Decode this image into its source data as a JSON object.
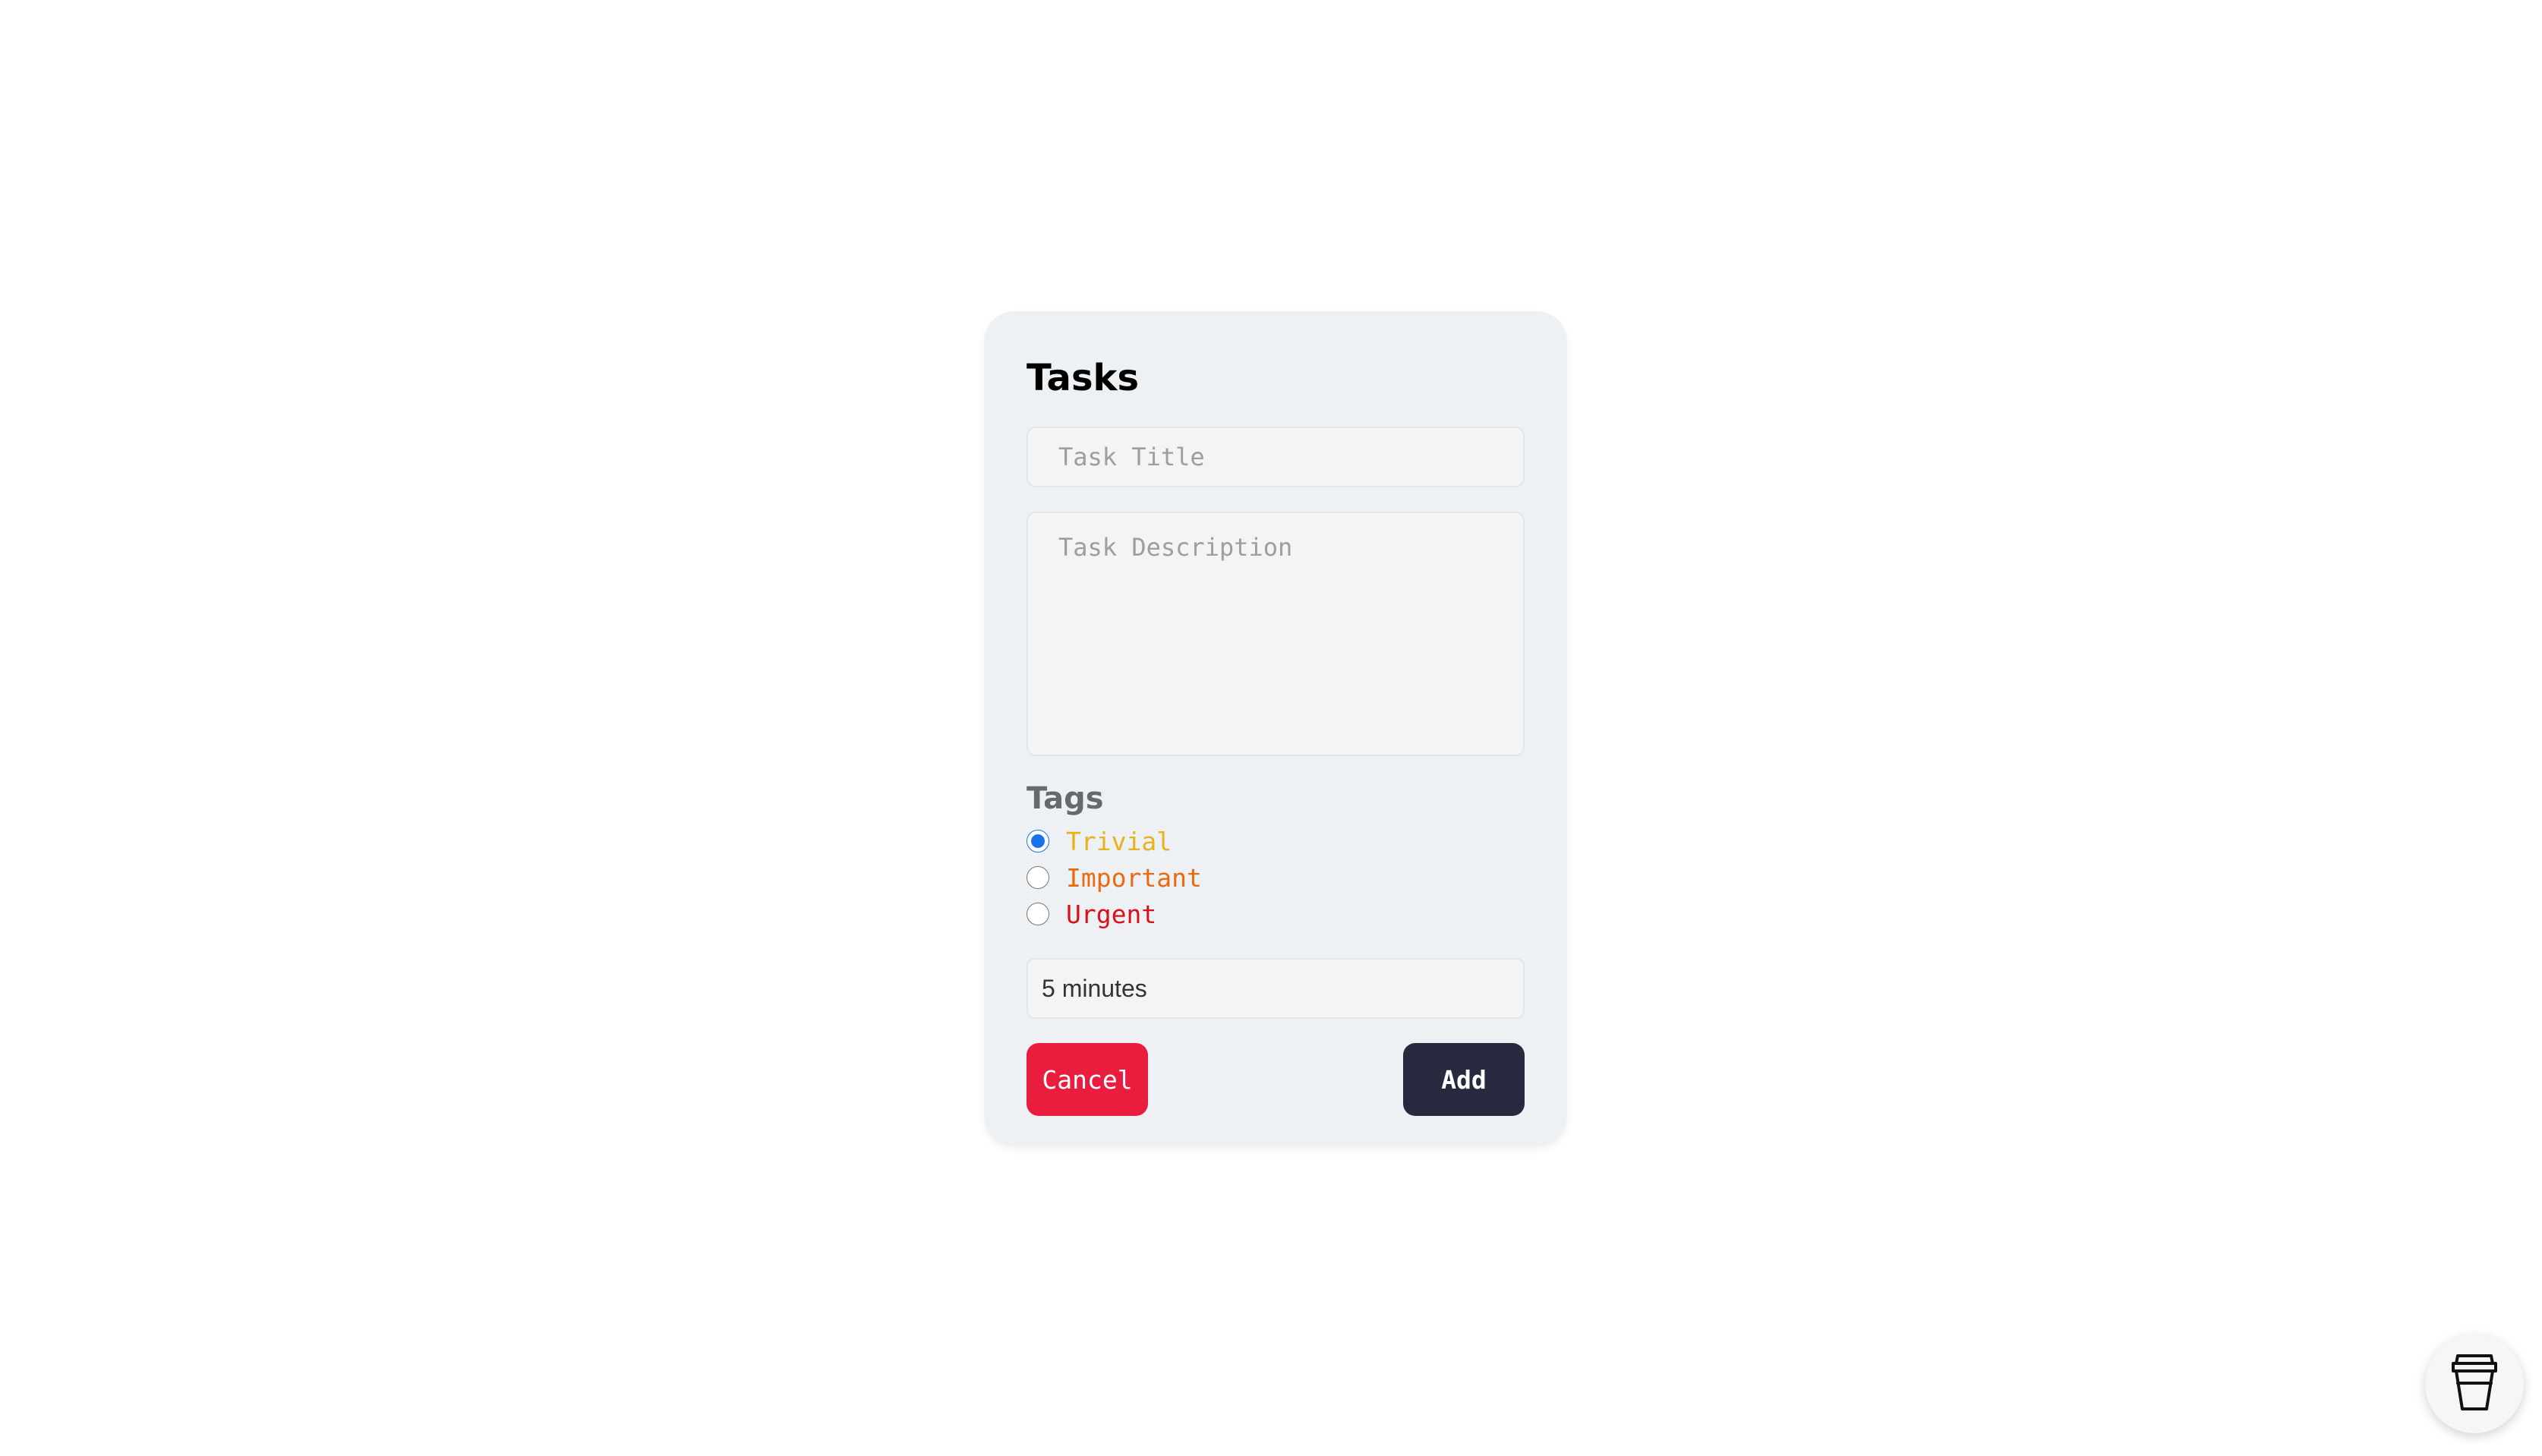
{
  "form": {
    "title": "Tasks",
    "title_placeholder": "Task Title",
    "description_placeholder": "Task Description",
    "tags_label": "Tags",
    "tags": [
      {
        "label": "Trivial",
        "color": "#e8b21c",
        "selected": true
      },
      {
        "label": "Important",
        "color": "#ea6a12",
        "selected": false
      },
      {
        "label": "Urgent",
        "color": "#d8101c",
        "selected": false
      }
    ],
    "duration": "5 minutes",
    "cancel_label": "Cancel",
    "add_label": "Add"
  },
  "colors": {
    "card_background": "#edf1f4",
    "cancel_button": "#eb1d3f",
    "add_button": "#272a3e",
    "radio_accent": "#1a73e8"
  },
  "fab": {
    "icon": "coffee-cup-icon"
  }
}
